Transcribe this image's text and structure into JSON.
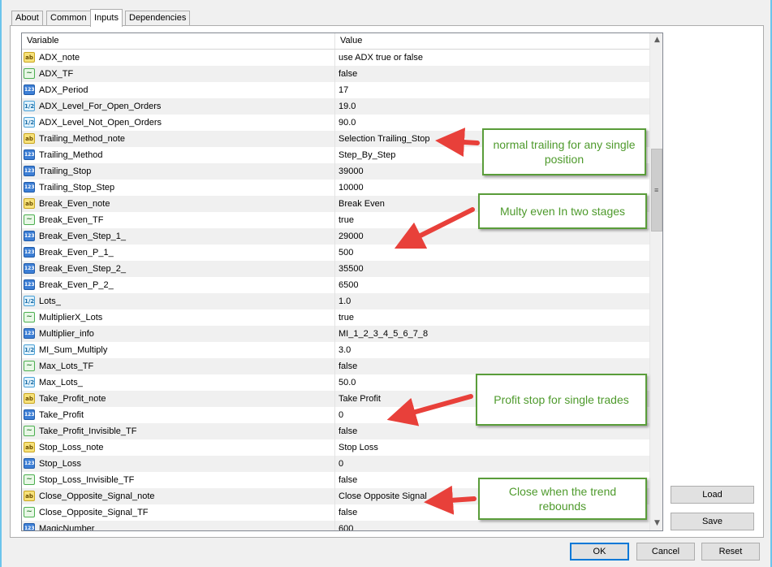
{
  "tabs": [
    "About",
    "Common",
    "Inputs",
    "Dependencies"
  ],
  "active_tab": "Inputs",
  "grid": {
    "headers": {
      "variable": "Variable",
      "value": "Value"
    },
    "rows": [
      {
        "icon": "ab",
        "name": "ADX_note",
        "value": "use ADX true or false"
      },
      {
        "icon": "bool",
        "name": "ADX_TF",
        "value": "false"
      },
      {
        "icon": "int",
        "name": "ADX_Period",
        "value": "17"
      },
      {
        "icon": "dbl",
        "name": "ADX_Level_For_Open_Orders",
        "value": "19.0"
      },
      {
        "icon": "dbl",
        "name": "ADX_Level_Not_Open_Orders",
        "value": "90.0"
      },
      {
        "icon": "ab",
        "name": "Trailing_Method_note",
        "value": "Selection Trailing_Stop"
      },
      {
        "icon": "int",
        "name": "Trailing_Method",
        "value": "Step_By_Step"
      },
      {
        "icon": "int",
        "name": "Trailing_Stop",
        "value": "39000"
      },
      {
        "icon": "int",
        "name": "Trailing_Stop_Step",
        "value": "10000"
      },
      {
        "icon": "ab",
        "name": "Break_Even_note",
        "value": "Break Even"
      },
      {
        "icon": "bool",
        "name": "Break_Even_TF",
        "value": "true"
      },
      {
        "icon": "int",
        "name": "Break_Even_Step_1_",
        "value": "29000"
      },
      {
        "icon": "int",
        "name": "Break_Even_P_1_",
        "value": "500"
      },
      {
        "icon": "int",
        "name": "Break_Even_Step_2_",
        "value": "35500"
      },
      {
        "icon": "int",
        "name": "Break_Even_P_2_",
        "value": "6500"
      },
      {
        "icon": "dbl",
        "name": "Lots_",
        "value": "1.0"
      },
      {
        "icon": "bool",
        "name": "MultiplierX_Lots",
        "value": "true"
      },
      {
        "icon": "int",
        "name": "Multiplier_info",
        "value": "MI_1_2_3_4_5_6_7_8"
      },
      {
        "icon": "dbl",
        "name": "MI_Sum_Multiply",
        "value": "3.0"
      },
      {
        "icon": "bool",
        "name": "Max_Lots_TF",
        "value": "false"
      },
      {
        "icon": "dbl",
        "name": "Max_Lots_",
        "value": "50.0"
      },
      {
        "icon": "ab",
        "name": "Take_Profit_note",
        "value": "Take Profit"
      },
      {
        "icon": "int",
        "name": "Take_Profit",
        "value": "0"
      },
      {
        "icon": "bool",
        "name": "Take_Profit_Invisible_TF",
        "value": "false"
      },
      {
        "icon": "ab",
        "name": "Stop_Loss_note",
        "value": "Stop Loss"
      },
      {
        "icon": "int",
        "name": "Stop_Loss",
        "value": "0"
      },
      {
        "icon": "bool",
        "name": "Stop_Loss_Invisible_TF",
        "value": "false"
      },
      {
        "icon": "ab",
        "name": "Close_Opposite_Signal_note",
        "value": "Close Opposite Signal"
      },
      {
        "icon": "bool",
        "name": "Close_Opposite_Signal_TF",
        "value": "false"
      },
      {
        "icon": "int",
        "name": "MagicNumber",
        "value": "600"
      }
    ],
    "icon_glyphs": {
      "ab": "ab",
      "int": "123",
      "dbl": "1/2",
      "bool": "~"
    }
  },
  "buttons": {
    "load": "Load",
    "save": "Save",
    "ok": "OK",
    "cancel": "Cancel",
    "reset": "Reset"
  },
  "annotations": [
    "normal trailing for any single position",
    "Multy even In two stages",
    "Profit stop for single trades",
    "Close when the trend rebounds"
  ],
  "colors": {
    "annotation_text": "#4e9a2c",
    "annotation_border": "#5a9d3a",
    "arrow": "#e8403a"
  }
}
